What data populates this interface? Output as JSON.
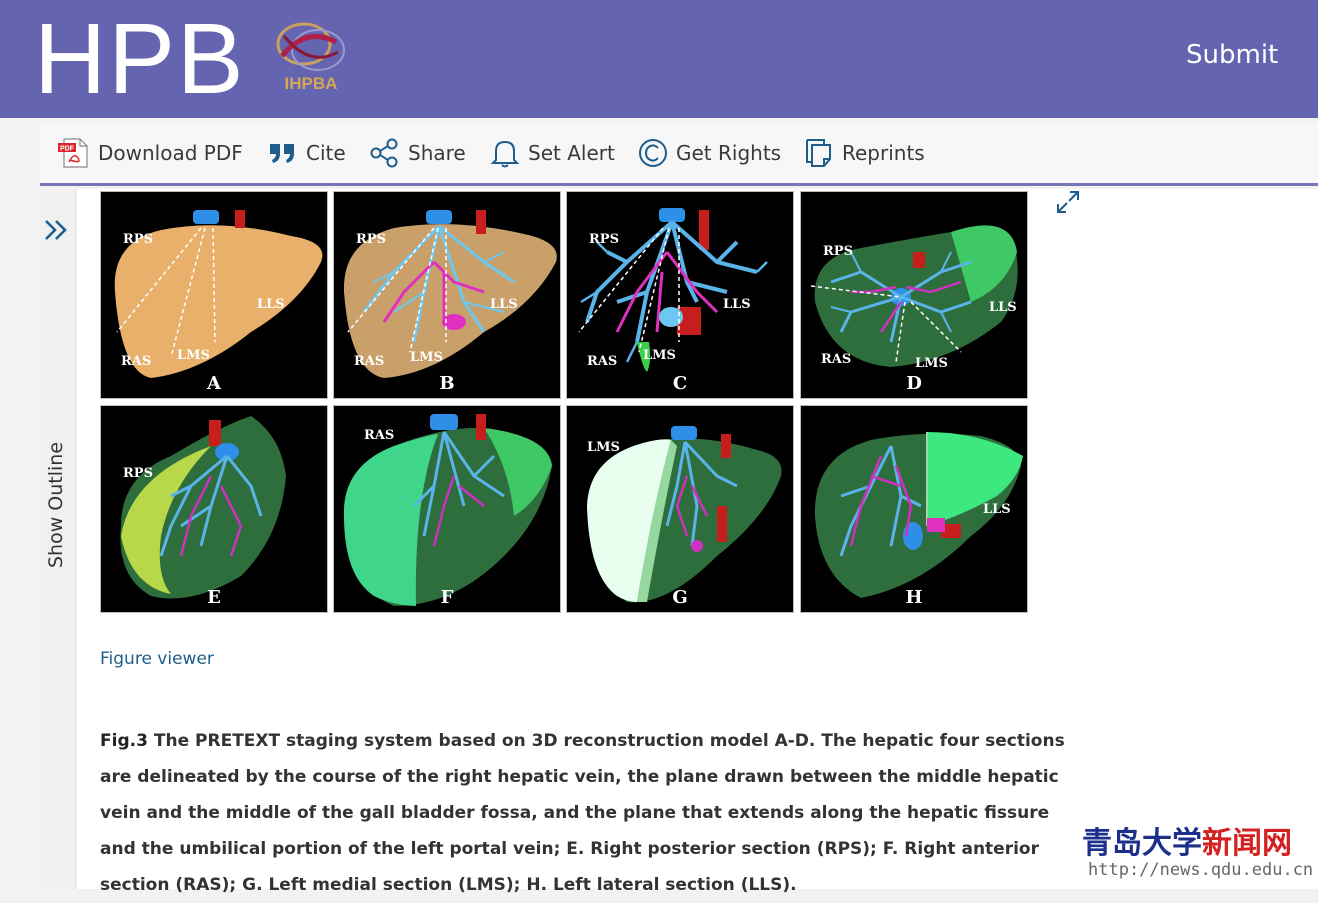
{
  "header": {
    "journal_title": "HPB",
    "logo_text": "IHPBA",
    "submit_label": "Submit",
    "brand_color": "#6464b0"
  },
  "toolbar": {
    "items": [
      {
        "label": "Download PDF",
        "icon": "pdf-icon"
      },
      {
        "label": "Cite",
        "icon": "quote-icon"
      },
      {
        "label": "Share",
        "icon": "share-icon"
      },
      {
        "label": "Set Alert",
        "icon": "bell-icon"
      },
      {
        "label": "Get Rights",
        "icon": "copyright-icon"
      },
      {
        "label": "Reprints",
        "icon": "reprints-icon"
      }
    ]
  },
  "sidebar": {
    "outline_label": "Show Outline",
    "icon": "double-chevron-right-icon"
  },
  "figure": {
    "panels": [
      {
        "letter": "A",
        "labels": [
          "RPS",
          "LLS",
          "RAS",
          "LMS"
        ]
      },
      {
        "letter": "B",
        "labels": [
          "RPS",
          "LLS",
          "RAS",
          "LMS"
        ]
      },
      {
        "letter": "C",
        "labels": [
          "RPS",
          "LLS",
          "RAS",
          "LMS"
        ]
      },
      {
        "letter": "D",
        "labels": [
          "RPS",
          "LLS",
          "RAS",
          "LMS"
        ]
      },
      {
        "letter": "E",
        "labels": [
          "RPS"
        ]
      },
      {
        "letter": "F",
        "labels": [
          "RAS"
        ]
      },
      {
        "letter": "G",
        "labels": [
          "LMS"
        ]
      },
      {
        "letter": "H",
        "labels": [
          "LLS"
        ]
      }
    ],
    "viewer_link": "Figure viewer",
    "expand_icon": "expand-icon"
  },
  "caption": {
    "fig_number": "Fig.3",
    "text": "The PRETEXT staging system based on 3D reconstruction model A-D. The hepatic four sections are delineated by the course of the right hepatic vein, the plane drawn between the middle hepatic vein and the middle of the gall bladder fossa, and the plane that extends along the hepatic fissure and the umbilical portion of the left portal vein; E. Right posterior section (RPS); F. Right anterior section (RAS); G. Left medial section (LMS); H. Left lateral section (LLS)."
  },
  "watermark": {
    "cn_part1": "青岛大学",
    "cn_part2": "新闻网",
    "url": "http://news.qdu.edu.cn"
  }
}
